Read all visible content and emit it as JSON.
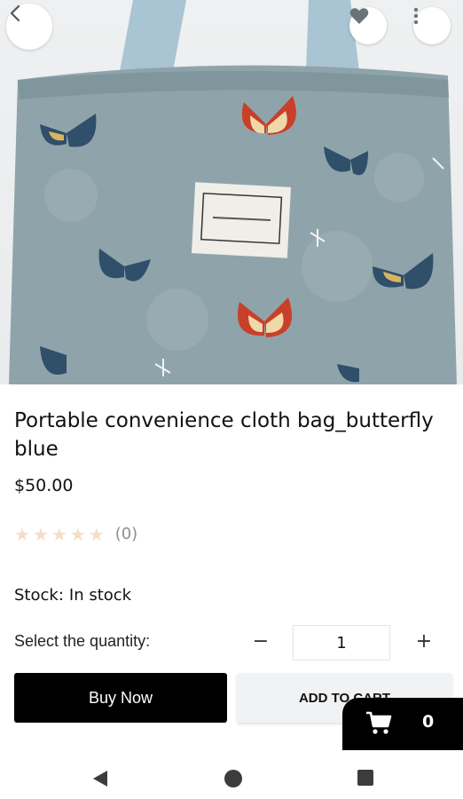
{
  "header": {
    "back_icon": "chevron-left-icon",
    "favorite_icon": "heart-icon",
    "more_icon": "more-vertical-icon"
  },
  "product": {
    "title": "Portable convenience cloth bag_butterfly blue",
    "price": "$50.00",
    "rating": 0,
    "rating_max": 5,
    "review_count": "(0)",
    "stock_label": "Stock:",
    "stock_value": "In stock"
  },
  "quantity": {
    "label": "Select the quantity:",
    "minus": "−",
    "value": "1",
    "plus": "+"
  },
  "actions": {
    "buy_now": "Buy Now",
    "add_to_cart": "ADD TO CART"
  },
  "cart": {
    "icon": "cart-icon",
    "count": "0"
  },
  "colors": {
    "primary": "#000000",
    "secondary_button": "#f1f2f4",
    "star_empty": "#f5ddc6",
    "bag": "#8fa4aa"
  },
  "system_nav": {
    "back_icon": "nav-back-icon",
    "home_icon": "nav-home-icon",
    "recents_icon": "nav-recents-icon"
  }
}
